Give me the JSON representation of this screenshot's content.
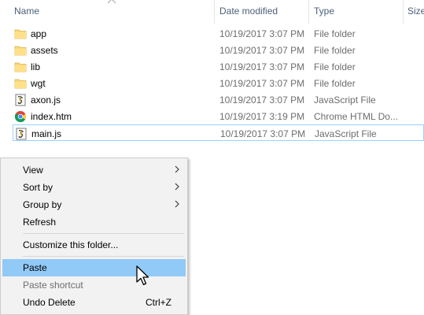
{
  "header": {
    "name": "Name",
    "date_modified": "Date modified",
    "type": "Type",
    "size": "Size"
  },
  "files": [
    {
      "name": "app",
      "date": "10/19/2017 3:07 PM",
      "type": "File folder",
      "icon": "folder-icon"
    },
    {
      "name": "assets",
      "date": "10/19/2017 3:07 PM",
      "type": "File folder",
      "icon": "folder-icon"
    },
    {
      "name": "lib",
      "date": "10/19/2017 3:07 PM",
      "type": "File folder",
      "icon": "folder-icon"
    },
    {
      "name": "wgt",
      "date": "10/19/2017 3:07 PM",
      "type": "File folder",
      "icon": "folder-icon"
    },
    {
      "name": "axon.js",
      "date": "10/19/2017 3:07 PM",
      "type": "JavaScript File",
      "icon": "javascript-file-icon"
    },
    {
      "name": "index.htm",
      "date": "10/19/2017 3:19 PM",
      "type": "Chrome HTML Do...",
      "icon": "chrome-icon"
    },
    {
      "name": "main.js",
      "date": "10/19/2017 3:07 PM",
      "type": "JavaScript File",
      "icon": "javascript-file-icon",
      "selected": true
    }
  ],
  "context_menu": {
    "view": "View",
    "sort_by": "Sort by",
    "group_by": "Group by",
    "refresh": "Refresh",
    "customize": "Customize this folder...",
    "paste": "Paste",
    "paste_shortcut": "Paste shortcut",
    "undo_delete": "Undo Delete",
    "undo_delete_shortcut": "Ctrl+Z"
  },
  "colors": {
    "header_text": "#4c607a",
    "folder": "#f8d775",
    "menu_bg": "#f2f2f2",
    "menu_highlight": "#91c9f7",
    "selection_border": "#99d1ff"
  }
}
